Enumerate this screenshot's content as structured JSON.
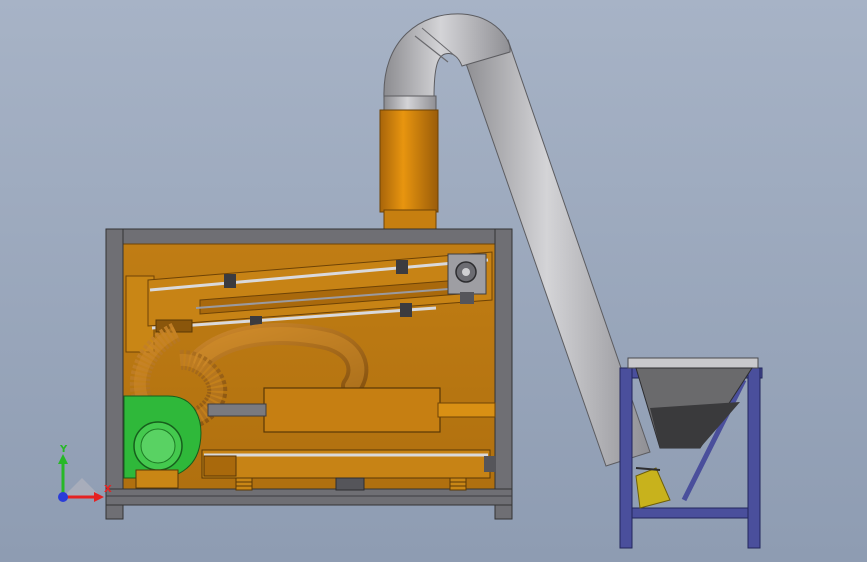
{
  "viewport": {
    "background_top": "#a7b3c6",
    "background_bottom": "#8e9cb2"
  },
  "colors": {
    "machine_body": "#bd7a12",
    "machine_body_light": "#d88d16",
    "machine_body_dark": "#8a560b",
    "frame": "#6f6f74",
    "frame_dark": "#3d3d42",
    "duct_pipe": "#b0b0b4",
    "fan_motor": "#2fb83a",
    "hopper_frame": "#4a4f9c",
    "hopper_bin": "#5a5a5c",
    "yellow_part": "#c8b21c"
  },
  "triad": {
    "x_label": "X",
    "y_label": "Y",
    "x_color": "#e52222",
    "y_color": "#27b827",
    "z_color": "#2a3cd8"
  }
}
